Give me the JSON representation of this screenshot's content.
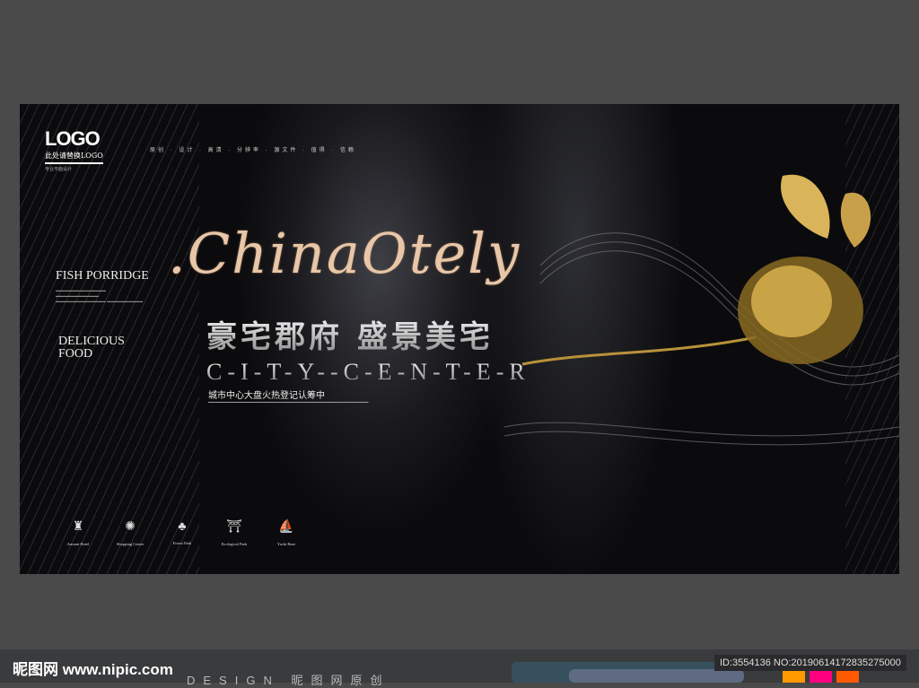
{
  "poster": {
    "logo": "LOGO",
    "logo_sub": "此处请替换LOGO",
    "logo_small": "专业平面设计",
    "nav": "原创 · 设计 · 高清 · 分辨率 · 源文件 · 值得 · 信赖",
    "script_title": ".ChinaOtely",
    "fish": "FISH PORRIDGE",
    "delicious": "DELICIOUS",
    "food": "FOOD",
    "cn_title": "豪宅郡府 盛景美宅",
    "city": "C-I-T-Y--C-E-N-T-E-R",
    "city_cn": "城市中心大盘火热登记认筹中",
    "icons": [
      {
        "icon": "hotel-icon",
        "glyph": "♜",
        "label": "Armani Hotel"
      },
      {
        "icon": "shopping-icon",
        "glyph": "✺",
        "label": "Shopping Center"
      },
      {
        "icon": "tree-icon",
        "glyph": "♣",
        "label": "Forest Park"
      },
      {
        "icon": "pavilion-icon",
        "glyph": "⛩",
        "label": "Ecological Park"
      },
      {
        "icon": "yacht-icon",
        "glyph": "⛵",
        "label": "Yacht Base"
      }
    ]
  },
  "footer": {
    "site": "昵图网 www.nipic.com",
    "id": "ID:3554136 NO:20190614172835275000",
    "design": "DESIGN 昵图网原创"
  },
  "colors": {
    "orange": "#ff9900",
    "pink": "#ff0080",
    "red": "#ff5a00"
  }
}
